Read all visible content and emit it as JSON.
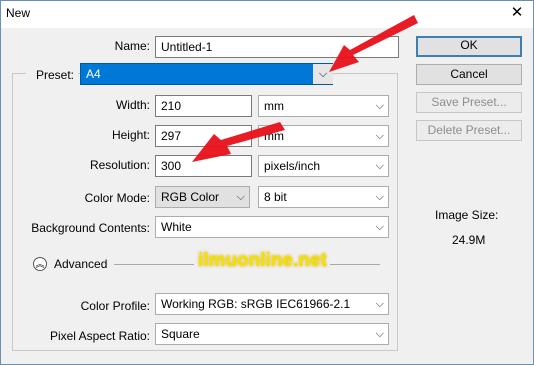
{
  "window": {
    "title": "New",
    "close_glyph": "✕"
  },
  "form": {
    "name_label": "Name:",
    "name_value": "Untitled-1",
    "preset_label": "Preset:",
    "preset_value": "A4",
    "width_label": "Width:",
    "width_value": "210",
    "width_unit": "mm",
    "height_label": "Height:",
    "height_value": "297",
    "height_unit": "mm",
    "resolution_label": "Resolution:",
    "resolution_value": "300",
    "resolution_unit": "pixels/inch",
    "color_mode_label": "Color Mode:",
    "color_mode_value": "RGB Color",
    "bit_depth_value": "8 bit",
    "background_label": "Background Contents:",
    "background_value": "White",
    "advanced_label": "Advanced",
    "color_profile_label": "Color Profile:",
    "color_profile_value": "Working RGB:  sRGB IEC61966-2.1",
    "pixel_aspect_label": "Pixel Aspect Ratio:",
    "pixel_aspect_value": "Square"
  },
  "buttons": {
    "ok": "OK",
    "cancel": "Cancel",
    "save_preset": "Save Preset...",
    "delete_preset": "Delete Preset..."
  },
  "info": {
    "image_size_label": "Image Size:",
    "image_size_value": "24.9M"
  },
  "watermark": "ilmuonline.net",
  "colors": {
    "accent": "#0078d7",
    "arrow": "#e8101a",
    "watermark": "#f2e200"
  }
}
